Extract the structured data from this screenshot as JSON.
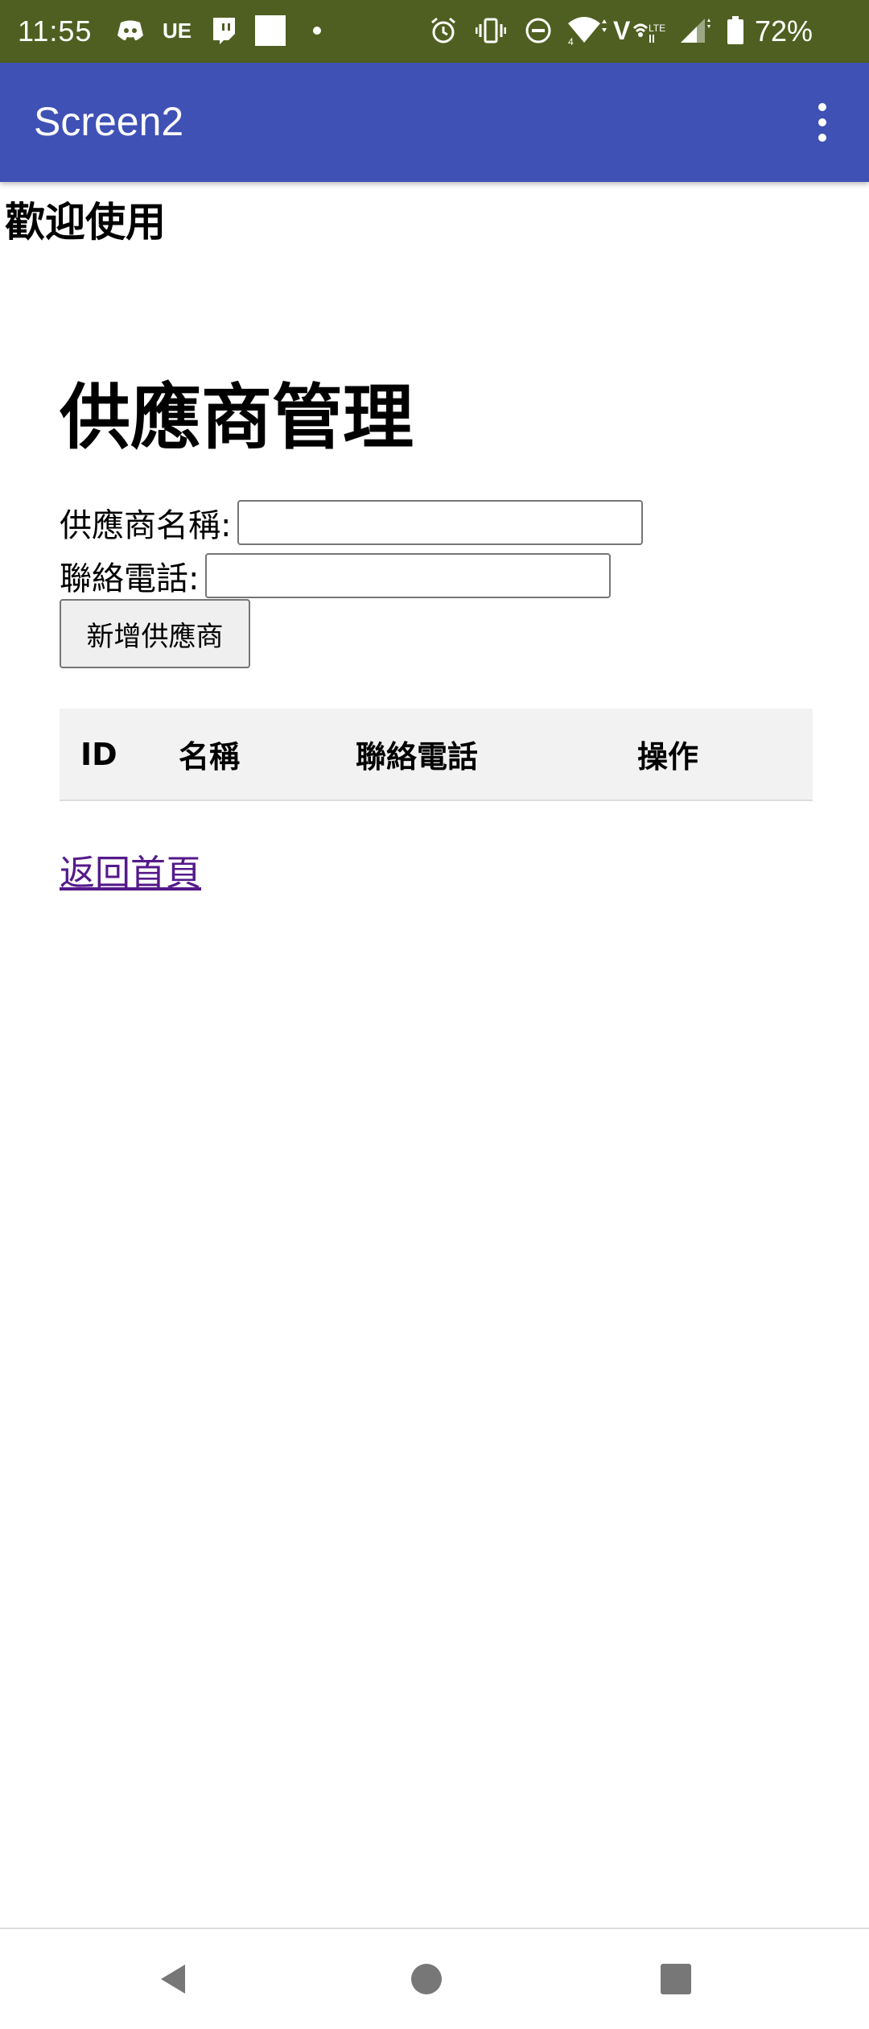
{
  "status_bar": {
    "time": "11:55",
    "carrier_badge": "UE",
    "battery_percent": "72%",
    "icons": [
      "discord-icon",
      "ue-icon",
      "twitch-icon",
      "square-icon",
      "dot-icon",
      "alarm-icon",
      "vibrate-icon",
      "dnd-icon",
      "wifi-icon",
      "volte-icon",
      "signal-icon",
      "battery-icon"
    ]
  },
  "app_bar": {
    "title": "Screen2",
    "menu_icon": "more-vert-icon"
  },
  "content": {
    "welcome_text": "歡迎使用",
    "heading": "供應商管理",
    "form": {
      "name_label": "供應商名稱:",
      "name_value": "",
      "phone_label": "聯絡電話:",
      "phone_value": "",
      "add_button": "新增供應商"
    },
    "table": {
      "headers": [
        "ID",
        "名稱",
        "聯絡電話",
        "操作"
      ],
      "rows": []
    },
    "back_link": "返回首頁"
  },
  "colors": {
    "status_bar_bg": "#4f5f21",
    "app_bar_bg": "#3f51b5",
    "table_header_bg": "#f2f2f2",
    "link_visited": "#551a8b"
  },
  "nav_bar": {
    "icons": [
      "back-icon",
      "home-icon",
      "recents-icon"
    ]
  }
}
